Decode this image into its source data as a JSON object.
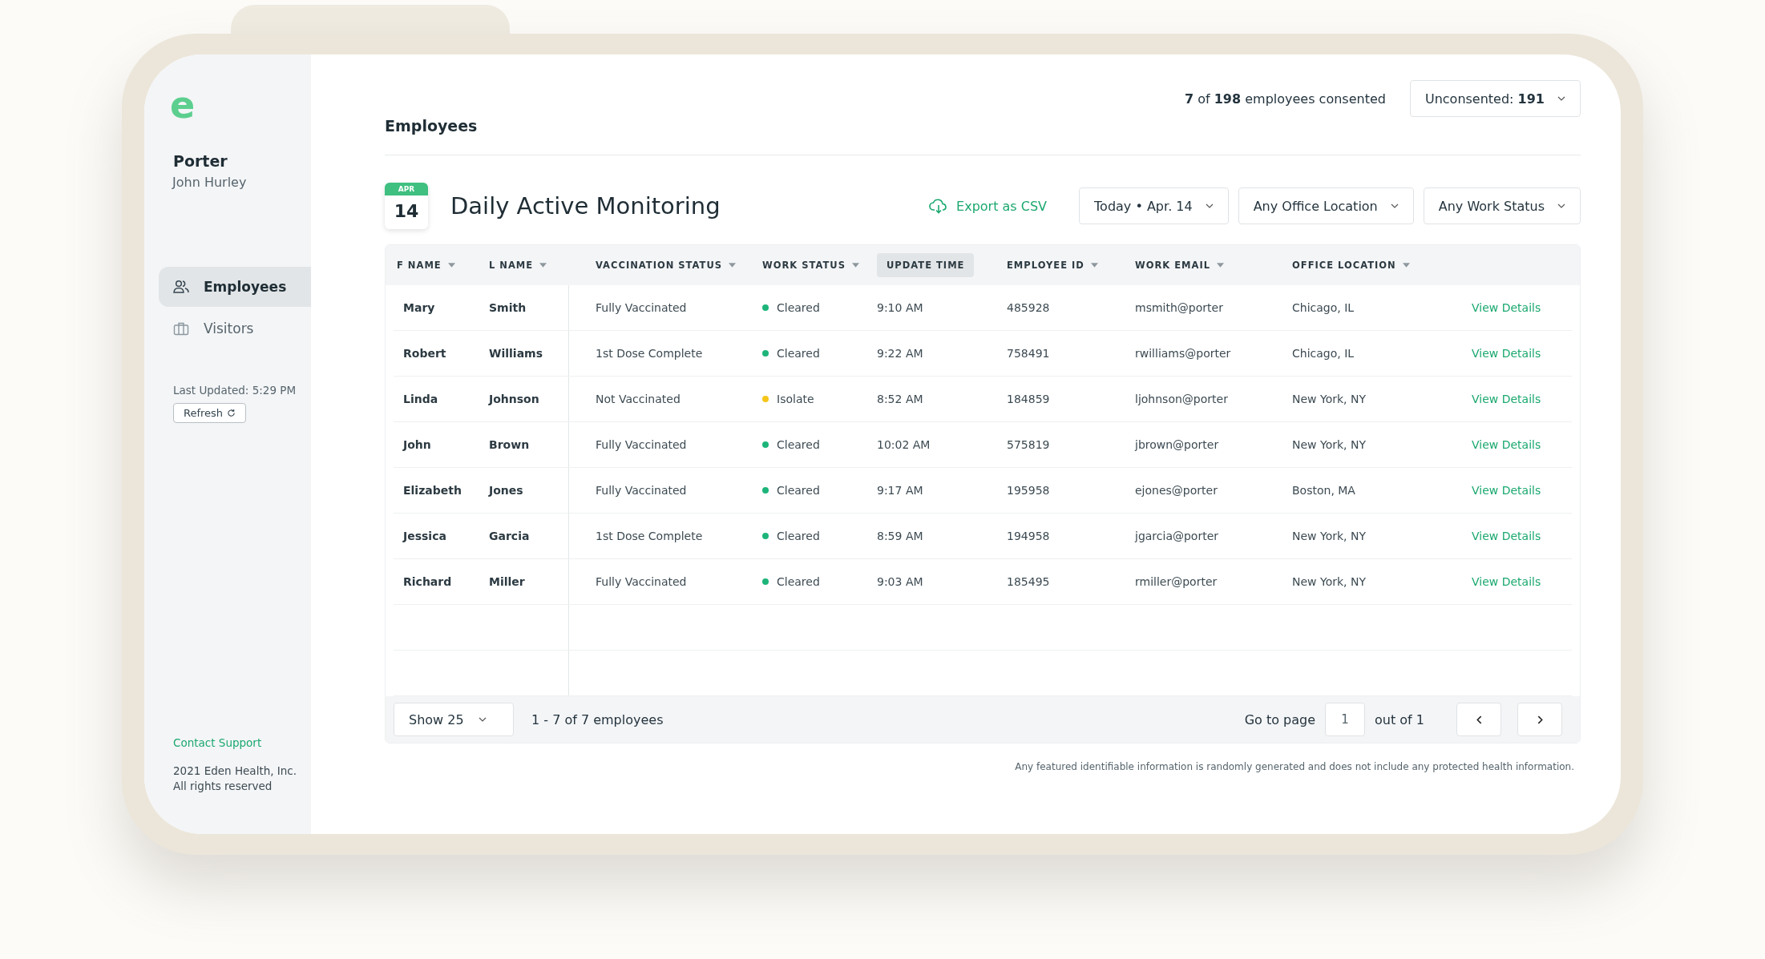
{
  "sidebar": {
    "logo": "e",
    "company": "Porter",
    "user": "John Hurley",
    "items": [
      {
        "label": "Employees",
        "selected": true
      },
      {
        "label": "Visitors",
        "selected": false
      }
    ],
    "last_updated": "Last Updated: 5:29 PM",
    "refresh_button": "Refresh",
    "contact_link": "Contact Support",
    "copyright": [
      "2021 Eden Health, Inc.",
      "All rights reserved"
    ]
  },
  "header": {
    "page_title": "Employees",
    "consent_summary": "**7** of **198** employees consented",
    "unconsented_dropdown": "Unconsented: **191**"
  },
  "monitoring": {
    "calendar_month": "APR",
    "calendar_day": "14",
    "title": "Daily Active Monitoring",
    "export_button": "Export as CSV",
    "filters": [
      "Today • Apr. 14",
      "Any Office Location",
      "Any Work Status"
    ]
  },
  "table": {
    "columns": [
      {
        "label": "F NAME",
        "sortable": true,
        "selected": false
      },
      {
        "label": "L NAME",
        "sortable": true,
        "selected": false
      },
      {
        "label": "VACCINATION STATUS",
        "sortable": true,
        "selected": false
      },
      {
        "label": "WORK STATUS",
        "sortable": true,
        "selected": false
      },
      {
        "label": "UPDATE TIME",
        "sortable": false,
        "selected": true
      },
      {
        "label": "EMPLOYEE ID",
        "sortable": true,
        "selected": false
      },
      {
        "label": "WORK EMAIL",
        "sortable": true,
        "selected": false
      },
      {
        "label": "OFFICE LOCATION",
        "sortable": true,
        "selected": false
      }
    ],
    "rows": [
      {
        "f_name": "Mary",
        "l_name": "Smith",
        "vaccination": "Fully Vaccinated",
        "work_status": "Cleared",
        "color": "#1db47a",
        "update_time": "9:10 AM",
        "employee_id": "485928",
        "email": "msmith@porter",
        "office": "Chicago, IL",
        "action": "View Details"
      },
      {
        "f_name": "Robert",
        "l_name": "Williams",
        "vaccination": "1st Dose Complete",
        "work_status": "Cleared",
        "color": "#1db47a",
        "update_time": "9:22 AM",
        "employee_id": "758491",
        "email": "rwilliams@porter",
        "office": "Chicago, IL",
        "action": "View Details"
      },
      {
        "f_name": "Linda",
        "l_name": "Johnson",
        "vaccination": "Not Vaccinated",
        "work_status": "Isolate",
        "color": "#f5c518",
        "update_time": "8:52 AM",
        "employee_id": "184859",
        "email": "ljohnson@porter",
        "office": "New York, NY",
        "action": "View Details"
      },
      {
        "f_name": "John",
        "l_name": "Brown",
        "vaccination": "Fully Vaccinated",
        "work_status": "Cleared",
        "color": "#1db47a",
        "update_time": "10:02 AM",
        "employee_id": "575819",
        "email": "jbrown@porter",
        "office": "New York, NY",
        "action": "View Details"
      },
      {
        "f_name": "Elizabeth",
        "l_name": "Jones",
        "vaccination": "Fully Vaccinated",
        "work_status": "Cleared",
        "color": "#1db47a",
        "update_time": "9:17 AM",
        "employee_id": "195958",
        "email": "ejones@porter",
        "office": "Boston, MA",
        "action": "View Details"
      },
      {
        "f_name": "Jessica",
        "l_name": "Garcia",
        "vaccination": "1st Dose Complete",
        "work_status": "Cleared",
        "color": "#1db47a",
        "update_time": "8:59 AM",
        "employee_id": "194958",
        "email": "jgarcia@porter",
        "office": "New York, NY",
        "action": "View Details"
      },
      {
        "f_name": "Richard",
        "l_name": "Miller",
        "vaccination": "Fully Vaccinated",
        "work_status": "Cleared",
        "color": "#1db47a",
        "update_time": "9:03 AM",
        "employee_id": "185495",
        "email": "rmiller@porter",
        "office": "New York, NY",
        "action": "View Details"
      }
    ]
  },
  "pagination": {
    "page_size": "Show 25",
    "range": "1 - 7 of 7 employees",
    "goto_label": "Go to page",
    "page": "1",
    "total": "out of 1"
  },
  "disclaimer": "Any featured identifiable information is randomly generated and does not include any protected health information."
}
